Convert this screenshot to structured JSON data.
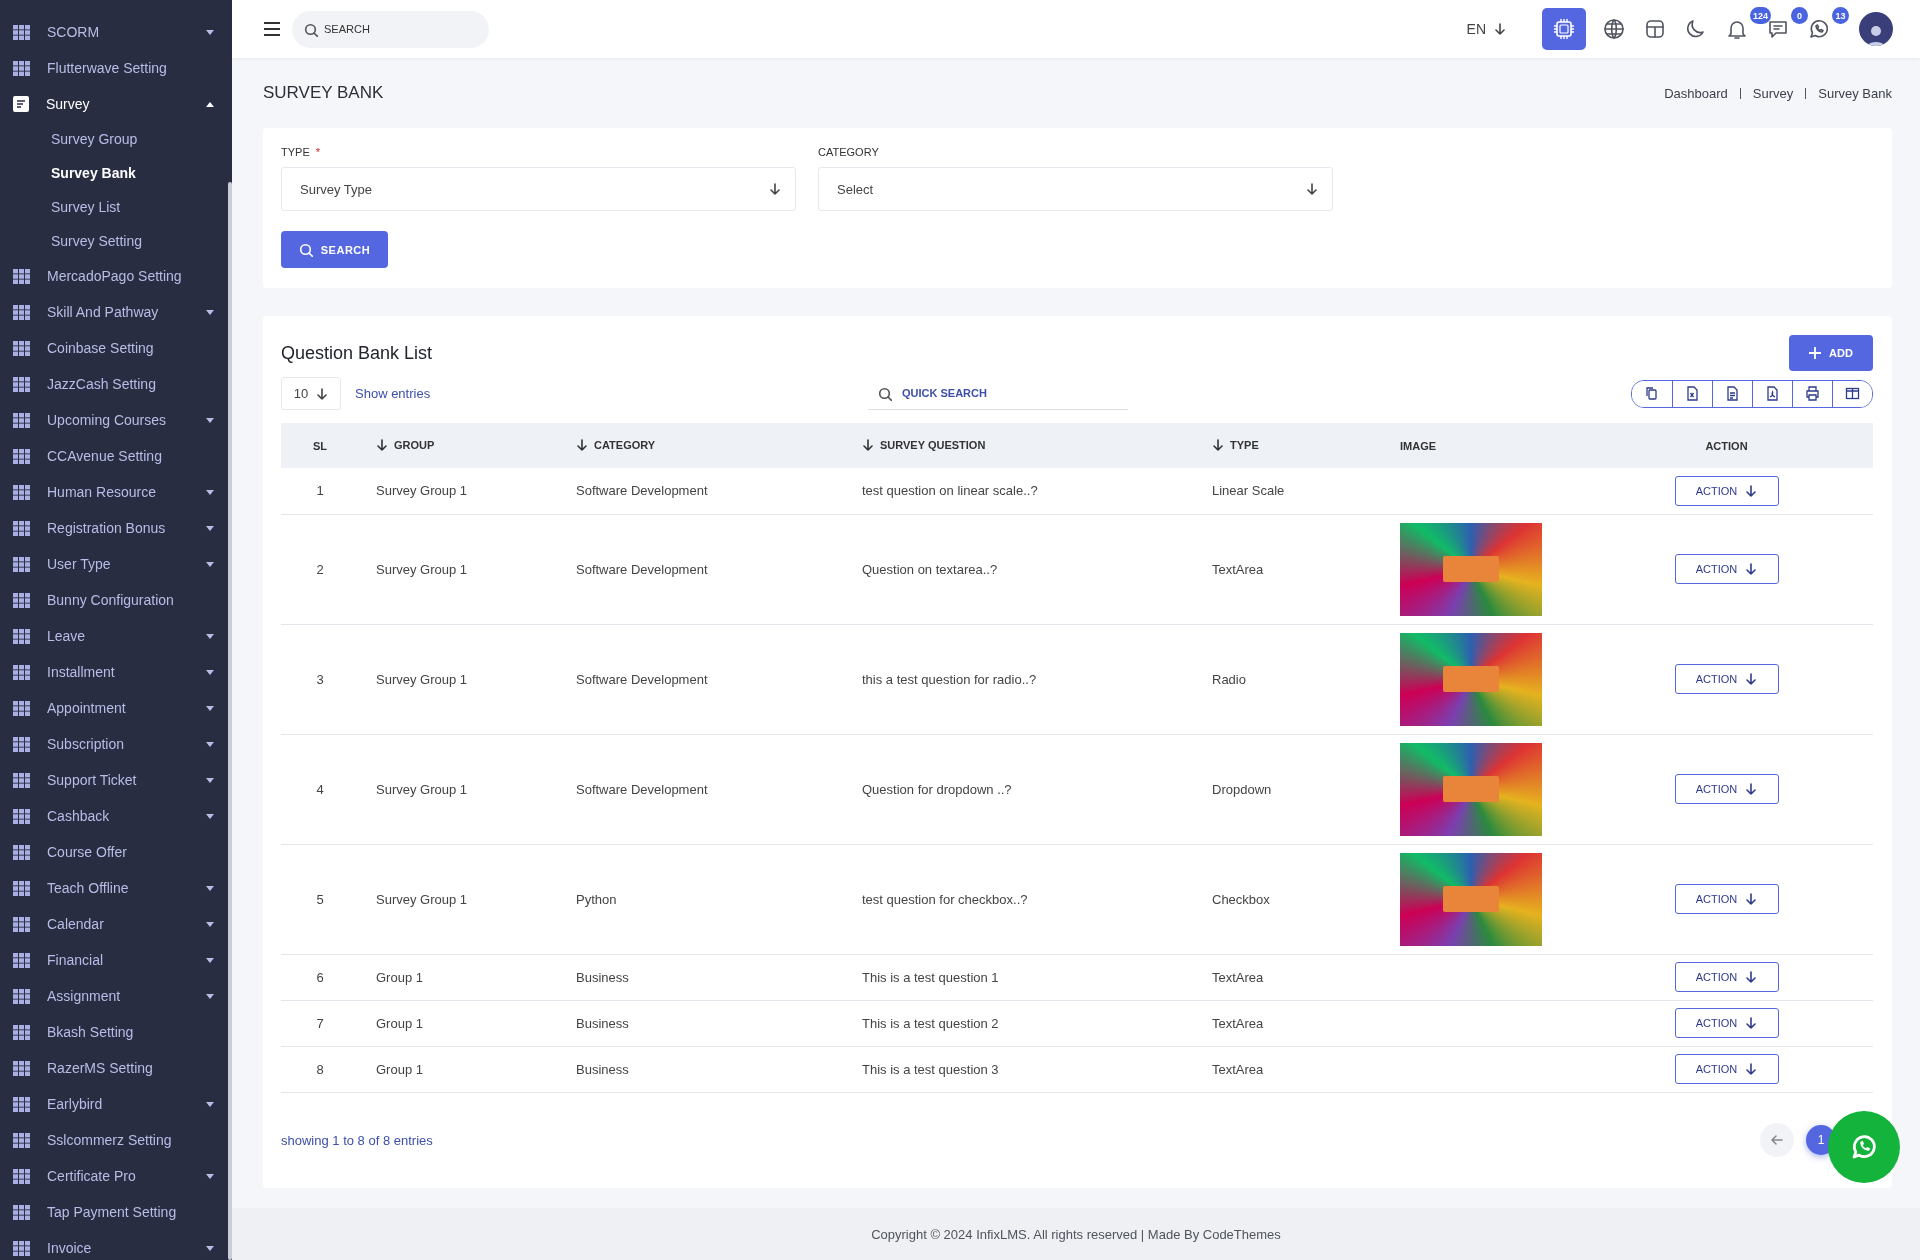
{
  "sidebar": {
    "items": [
      {
        "label": "SCORM",
        "kind": "menu",
        "expanded": false
      },
      {
        "label": "Flutterwave Setting",
        "kind": "link"
      },
      {
        "label": "Survey",
        "kind": "menu",
        "expanded": true,
        "children": [
          {
            "label": "Survey Group",
            "selected": false
          },
          {
            "label": "Survey Bank",
            "selected": true
          },
          {
            "label": "Survey List",
            "selected": false
          },
          {
            "label": "Survey Setting",
            "selected": false
          }
        ]
      },
      {
        "label": "MercadoPago Setting",
        "kind": "link"
      },
      {
        "label": "Skill And Pathway",
        "kind": "menu",
        "expanded": false
      },
      {
        "label": "Coinbase Setting",
        "kind": "link"
      },
      {
        "label": "JazzCash Setting",
        "kind": "link"
      },
      {
        "label": "Upcoming Courses",
        "kind": "menu",
        "expanded": false
      },
      {
        "label": "CCAvenue Setting",
        "kind": "link"
      },
      {
        "label": "Human Resource",
        "kind": "menu",
        "expanded": false
      },
      {
        "label": "Registration Bonus",
        "kind": "menu",
        "expanded": false
      },
      {
        "label": "User Type",
        "kind": "menu",
        "expanded": false
      },
      {
        "label": "Bunny Configuration",
        "kind": "link"
      },
      {
        "label": "Leave",
        "kind": "menu",
        "expanded": false
      },
      {
        "label": "Installment",
        "kind": "menu",
        "expanded": false
      },
      {
        "label": "Appointment",
        "kind": "menu",
        "expanded": false
      },
      {
        "label": "Subscription",
        "kind": "menu",
        "expanded": false
      },
      {
        "label": "Support Ticket",
        "kind": "menu",
        "expanded": false
      },
      {
        "label": "Cashback",
        "kind": "menu",
        "expanded": false
      },
      {
        "label": "Course Offer",
        "kind": "link"
      },
      {
        "label": "Teach Offline",
        "kind": "menu",
        "expanded": false
      },
      {
        "label": "Calendar",
        "kind": "menu",
        "expanded": false
      },
      {
        "label": "Financial",
        "kind": "menu",
        "expanded": false
      },
      {
        "label": "Assignment",
        "kind": "menu",
        "expanded": false
      },
      {
        "label": "Bkash Setting",
        "kind": "link"
      },
      {
        "label": "RazerMS Setting",
        "kind": "link"
      },
      {
        "label": "Earlybird",
        "kind": "menu",
        "expanded": false
      },
      {
        "label": "Sslcommerz Setting",
        "kind": "link"
      },
      {
        "label": "Certificate Pro",
        "kind": "menu",
        "expanded": false
      },
      {
        "label": "Tap Payment Setting",
        "kind": "link"
      },
      {
        "label": "Invoice",
        "kind": "menu",
        "expanded": false
      }
    ]
  },
  "header": {
    "search": {
      "placeholder": "SEARCH"
    },
    "language": "EN",
    "tools": [
      {
        "kind": "ai"
      },
      {
        "kind": "globe"
      },
      {
        "kind": "layout"
      },
      {
        "kind": "moon"
      },
      {
        "kind": "bell",
        "badge": "124"
      },
      {
        "kind": "chat",
        "badge": "0"
      },
      {
        "kind": "whatsapp",
        "badge": "13"
      }
    ]
  },
  "page": {
    "title": "SURVEY BANK",
    "breadcrumb": [
      "Dashboard",
      "Survey",
      "Survey Bank"
    ]
  },
  "filters": {
    "fields": [
      {
        "label": "TYPE",
        "required_mark": "*",
        "value": "Survey Type"
      },
      {
        "label": "CATEGORY",
        "value": "Select"
      }
    ],
    "search_button": "SEARCH"
  },
  "table_card": {
    "title": "Question Bank List",
    "add_button": "ADD",
    "page_size": "10",
    "show_entries": "Show entries",
    "quick_search": {
      "placeholder": "QUICK SEARCH"
    },
    "columns": [
      {
        "label": "SL",
        "sortable": false
      },
      {
        "label": "GROUP",
        "sortable": true
      },
      {
        "label": "CATEGORY",
        "sortable": true
      },
      {
        "label": "SURVEY QUESTION",
        "sortable": true
      },
      {
        "label": "TYPE",
        "sortable": true
      },
      {
        "label": "IMAGE",
        "sortable": false
      },
      {
        "label": "ACTION",
        "sortable": false
      }
    ],
    "rows": [
      {
        "sl": "1",
        "group": "Survey Group 1",
        "category": "Software Development",
        "question": "test question on linear scale..?",
        "type": "Linear Scale",
        "has_image": false,
        "action": "ACTION"
      },
      {
        "sl": "2",
        "group": "Survey Group 1",
        "category": "Software Development",
        "question": "Question on textarea..?",
        "type": "TextArea",
        "has_image": true,
        "action": "ACTION"
      },
      {
        "sl": "3",
        "group": "Survey Group 1",
        "category": "Software Development",
        "question": "this a test question for radio..?",
        "type": "Radio",
        "has_image": true,
        "action": "ACTION"
      },
      {
        "sl": "4",
        "group": "Survey Group 1",
        "category": "Software Development",
        "question": "Question for dropdown ..?",
        "type": "Dropdown",
        "has_image": true,
        "action": "ACTION"
      },
      {
        "sl": "5",
        "group": "Survey Group 1",
        "category": "Python",
        "question": "test question for checkbox..?",
        "type": "Checkbox",
        "has_image": true,
        "action": "ACTION"
      },
      {
        "sl": "6",
        "group": "Group 1",
        "category": "Business",
        "question": "This is a test question 1",
        "type": "TextArea",
        "has_image": false,
        "action": "ACTION"
      },
      {
        "sl": "7",
        "group": "Group 1",
        "category": "Business",
        "question": "This is a test question 2",
        "type": "TextArea",
        "has_image": false,
        "action": "ACTION"
      },
      {
        "sl": "8",
        "group": "Group 1",
        "category": "Business",
        "question": "This is a test question 3",
        "type": "TextArea",
        "has_image": false,
        "action": "ACTION"
      }
    ],
    "summary": "showing 1 to 8 of 8 entries",
    "pages": [
      {
        "label": "1",
        "selected": true
      }
    ]
  },
  "footer": {
    "copyright": "Copyright © 2024 InfixLMS. All rights reserved | Made By CodeThemes"
  }
}
